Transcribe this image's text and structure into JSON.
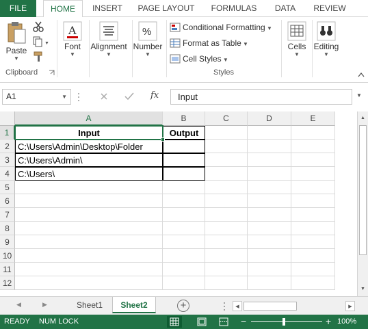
{
  "ribbon_tabs": [
    "FILE",
    "HOME",
    "INSERT",
    "PAGE LAYOUT",
    "FORMULAS",
    "DATA",
    "REVIEW"
  ],
  "clipboard": {
    "paste_label": "Paste",
    "group_label": "Clipboard"
  },
  "font": {
    "label": "Font"
  },
  "alignment": {
    "label": "Alignment"
  },
  "number": {
    "label": "Number"
  },
  "styles": {
    "conditional_formatting": "Conditional Formatting",
    "format_as_table": "Format as Table",
    "cell_styles": "Cell Styles",
    "group_label": "Styles"
  },
  "cells": {
    "label": "Cells"
  },
  "editing": {
    "label": "Editing"
  },
  "formula_bar": {
    "name_box": "A1",
    "fx": "fx",
    "formula": "Input"
  },
  "columns": [
    "A",
    "B",
    "C",
    "D",
    "E"
  ],
  "rows": [
    "1",
    "2",
    "3",
    "4",
    "5",
    "6",
    "7",
    "8",
    "9",
    "10",
    "11",
    "12"
  ],
  "cells_data": {
    "A1": "Input",
    "B1": "Output",
    "A2": "C:\\Users\\Admin\\Desktop\\Folder",
    "A3": "C:\\Users\\Admin\\",
    "A4": "C:\\Users\\"
  },
  "sheets": [
    "Sheet1",
    "Sheet2"
  ],
  "active_sheet": "Sheet2",
  "status_bar": {
    "mode": "READY",
    "num_lock": "NUM LOCK",
    "zoom_minus": "−",
    "zoom_plus": "+",
    "zoom": "100%"
  },
  "colors": {
    "accent": "#217346",
    "header_bg": "#f0f0f0"
  }
}
